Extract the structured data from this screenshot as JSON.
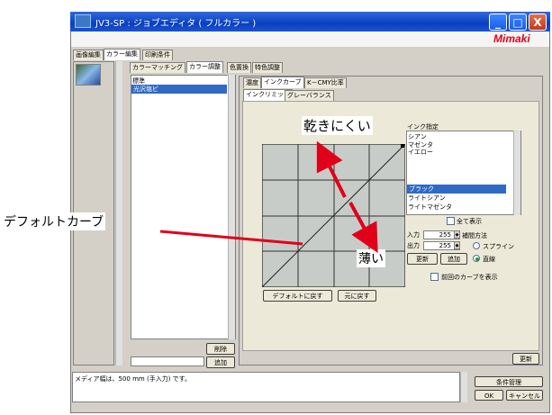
{
  "window": {
    "title": "JV3-SP : ジョブエディタ ( フルカラー )",
    "brand": "Mimaki",
    "controls": {
      "minimize": "_",
      "maximize": "□",
      "close": "X"
    }
  },
  "main_tabs": [
    "画像編集",
    "カラー編集",
    "印刷条件"
  ],
  "color_tabs": [
    "カラーマッチング",
    "カラー調整",
    "色置換",
    "特色調整"
  ],
  "sub_tabs": [
    "濃度",
    "インクカーブ",
    "K－CMY比率"
  ],
  "sub_sub_tabs": [
    "インクリミット",
    "グレーバランス"
  ],
  "media_list": {
    "items": [
      "標準",
      "光沢塩ビ"
    ],
    "selected_index": 1
  },
  "media_buttons": {
    "delete": "削除",
    "add": "追加"
  },
  "ink_panel": {
    "label": "インク指定",
    "items": [
      "シアン",
      "マゼンタ",
      "イエロー",
      "ブラック",
      "ライトシアン",
      "ライトマゼンタ"
    ],
    "selected_index": 3,
    "show_all_label": "全て表示",
    "input_label": "入力",
    "input_value": "255",
    "output_label": "出力",
    "output_value": "255",
    "interp_label": "補間方法",
    "spline_label": "スプライン",
    "linear_label": "直線",
    "update_button": "更新",
    "add_button": "追加",
    "prev_curve_label": "前回のカーブを表示"
  },
  "curve_buttons": {
    "default": "デフォルトに戻す",
    "original": "元に戻す"
  },
  "panel_update": "更新",
  "status_message": "メディア幅は、500 mm (手入力) です。",
  "footer": {
    "condition_mgmt": "条件管理",
    "ok": "OK",
    "cancel": "キャンセル"
  },
  "annotations": {
    "dry_hard": "乾きにくい",
    "thin": "薄い",
    "default_curve": "デフォルトカーブ"
  },
  "colors": {
    "accent_red": "#e0001a",
    "selection_blue": "#316ac5",
    "grid_bg": "#c8ccc8"
  }
}
